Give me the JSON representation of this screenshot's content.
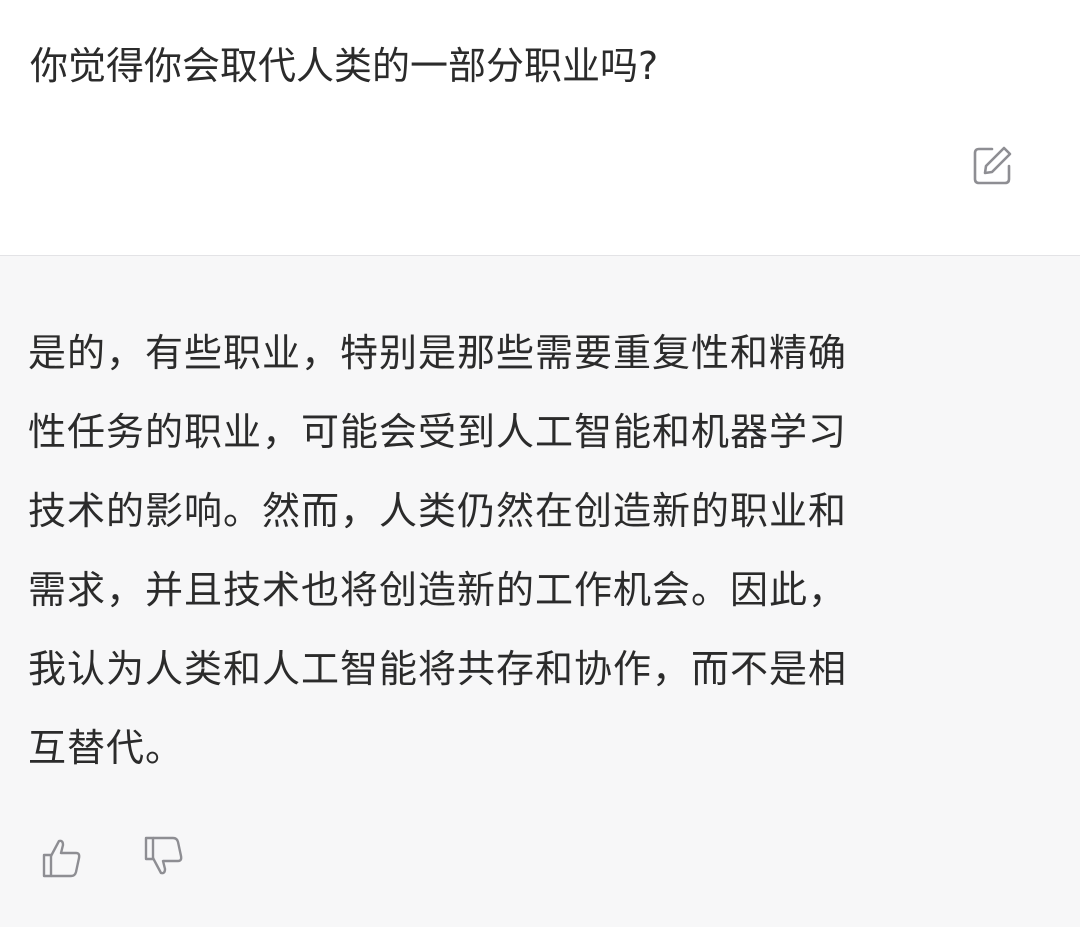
{
  "user_message": {
    "text": "你觉得你会取代人类的一部分职业吗?",
    "edit_icon": "edit-icon"
  },
  "assistant_message": {
    "text": "是的，有些职业，特别是那些需要重复性和精确\n性任务的职业，可能会受到人工智能和机器学习\n技术的影响。然而，人类仍然在创造新的职业和\n需求，并且技术也将创造新的工作机会。因此，\n我认为人类和人工智能将共存和协作，而不是相\n互替代。",
    "feedback_icons": [
      "thumbs-up-icon",
      "thumbs-down-icon"
    ]
  },
  "colors": {
    "user_background": "#ffffff",
    "assistant_background": "#f7f7f8",
    "text": "#2b2b2b",
    "icon": "#8e8e93"
  }
}
